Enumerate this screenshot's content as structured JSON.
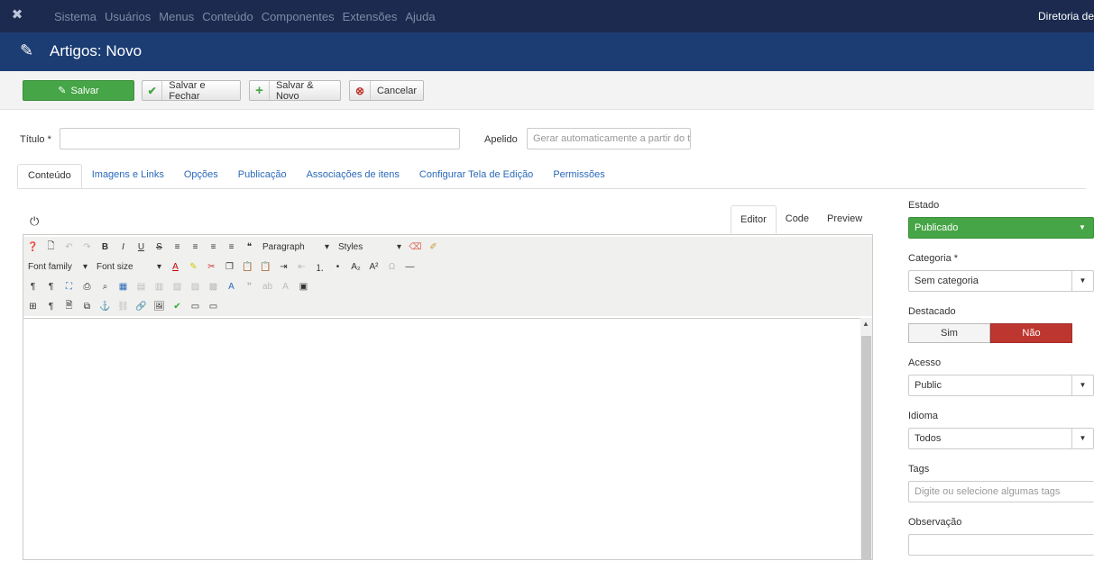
{
  "topnav": {
    "items": [
      "Sistema",
      "Usuários",
      "Menus",
      "Conteúdo",
      "Componentes",
      "Extensões",
      "Ajuda"
    ],
    "right_text": "Diretoria de"
  },
  "titlebar": {
    "title": "Artigos: Novo"
  },
  "toolbar": {
    "save": "Salvar",
    "save_close": "Salvar e Fechar",
    "save_new": "Salvar & Novo",
    "cancel": "Cancelar"
  },
  "form": {
    "title_label": "Título *",
    "title_value": "",
    "alias_label": "Apelido",
    "alias_placeholder": "Gerar automaticamente a partir do t"
  },
  "tabs": [
    "Conteúdo",
    "Imagens e Links",
    "Opções",
    "Publicação",
    "Associações de itens",
    "Configurar Tela de Edição",
    "Permissões"
  ],
  "editor": {
    "tabs": [
      "Editor",
      "Code",
      "Preview"
    ],
    "paragraph": "Paragraph",
    "styles": "Styles",
    "font_family": "Font family",
    "font_size": "Font size"
  },
  "sidebar": {
    "estado_label": "Estado",
    "estado_value": "Publicado",
    "categoria_label": "Categoria *",
    "categoria_value": "Sem categoria",
    "destacado_label": "Destacado",
    "destacado_sim": "Sim",
    "destacado_nao": "Não",
    "acesso_label": "Acesso",
    "acesso_value": "Public",
    "idioma_label": "Idioma",
    "idioma_value": "Todos",
    "tags_label": "Tags",
    "tags_placeholder": "Digite ou selecione algumas tags",
    "observacao_label": "Observação",
    "observacao_value": ""
  },
  "colors": {
    "nav": "#1b2a4e",
    "titlebar": "#1c3d74",
    "success": "#46a546",
    "danger": "#bd362f",
    "link": "#2a69b8"
  }
}
